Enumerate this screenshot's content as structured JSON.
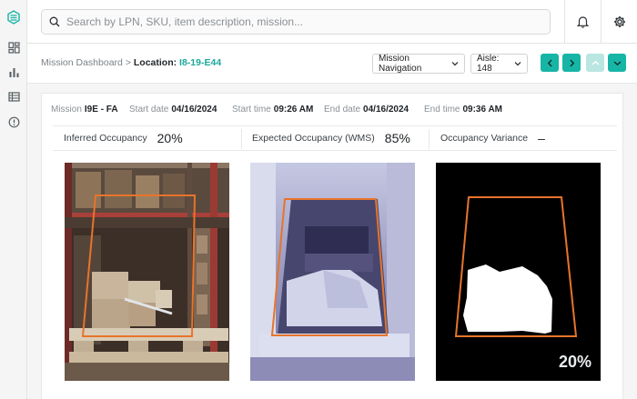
{
  "search": {
    "placeholder": "Search by LPN, SKU, item description, mission..."
  },
  "breadcrumb": {
    "parent": "Mission Dashboard",
    "separator": ">",
    "location_label": "Location:",
    "location_value": "I8-19-E44"
  },
  "controls": {
    "mission_navigation": "Mission Navigation",
    "aisle": "Aisle: 148"
  },
  "mission": {
    "mission_label": "Mission",
    "mission_value": "I9E - FA",
    "start_date_label": "Start date",
    "start_date_value": "04/16/2024",
    "start_time_label": "Start time",
    "start_time_value": "09:26 AM",
    "end_date_label": "End date",
    "end_date_value": "04/16/2024",
    "end_time_label": "End time",
    "end_time_value": "09:36 AM"
  },
  "occupancy": {
    "inferred_label": "Inferred Occupancy",
    "inferred_value": "20%",
    "expected_label": "Expected Occupancy (WMS)",
    "expected_value": "85%",
    "variance_label": "Occupancy Variance",
    "variance_value": "–"
  },
  "images": {
    "mask_percent": "20%"
  },
  "colors": {
    "accent": "#17b5a6",
    "accent_text": "#1ba79a",
    "bbox_orange": "#e8742a"
  },
  "icons": [
    "logo-icon",
    "dashboard-icon",
    "bar-chart-icon",
    "table-icon",
    "alert-circle-icon",
    "search-icon",
    "bell-icon",
    "gear-icon",
    "chevron-left-icon",
    "chevron-right-icon",
    "chevron-up-icon",
    "chevron-down-icon"
  ]
}
